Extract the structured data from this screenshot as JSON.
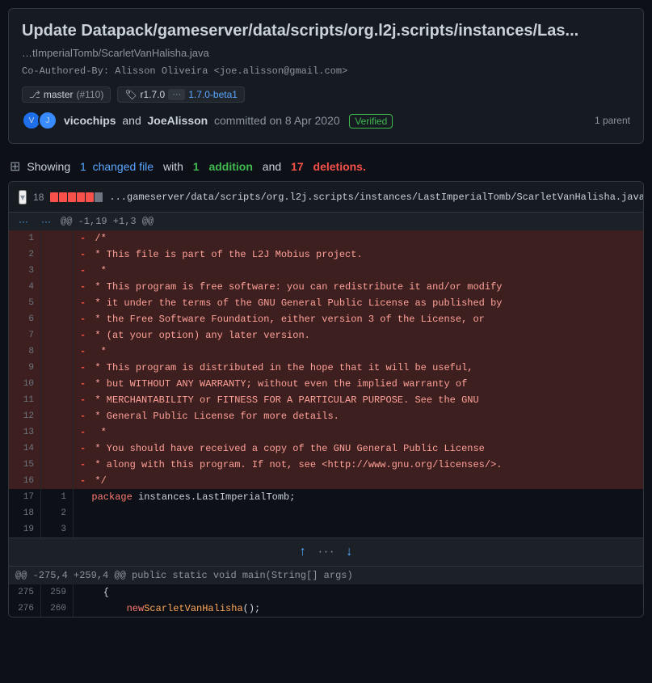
{
  "commit": {
    "title": "Update Datapack/gameserver/data/scripts/org.l2j.scripts/instances/Las...",
    "filepath": "…tImperialTomb/ScarletVanHalisha.java",
    "coauthored": "Co-Authored-By: Alisson Oliveira <joe.alisson@gmail.com>",
    "branch": "master",
    "pr_number": "(#110)",
    "tag": "r1.7.0",
    "tag_dots": "···",
    "tag_version": "1.7.0-beta1",
    "author1": "vicochips",
    "author2": "JoeAlisson",
    "committed_on": "committed on 8 Apr 2020",
    "verified_label": "Verified",
    "parent_label": "1 parent"
  },
  "diff_stats": {
    "showing_label": "Showing",
    "changed_count": "1",
    "changed_label": "changed file",
    "with_label": "with",
    "addition_count": "1",
    "addition_label": "addition",
    "and_label": "and",
    "deletion_count": "17",
    "deletion_label": "deletions."
  },
  "file_diff": {
    "changes_count": "18",
    "filename": "...gameserver/data/scripts/org.l2j.scripts/instances/LastImperialTomb/ScarletVanHalisha.java",
    "hunk_header": "@@ -1,19  +1,3 @@",
    "hunk_bottom": "@@ -275,4 +259,4 @@ public static void main(String[] args)",
    "lines": [
      {
        "old": "",
        "new": "",
        "type": "context",
        "content": "@@ -1,19  +1,3 @@"
      },
      {
        "old": "1",
        "new": "",
        "type": "del",
        "content": "- /*"
      },
      {
        "old": "2",
        "new": "",
        "type": "del",
        "content": "- * This file is part of the L2J Mobius project."
      },
      {
        "old": "3",
        "new": "",
        "type": "del",
        "content": "-  *"
      },
      {
        "old": "4",
        "new": "",
        "type": "del",
        "content": "- * This program is free software: you can redistribute it and/or modify"
      },
      {
        "old": "5",
        "new": "",
        "type": "del",
        "content": "- * it under the terms of the GNU General Public License as published by"
      },
      {
        "old": "6",
        "new": "",
        "type": "del",
        "content": "- * the Free Software Foundation, either version 3 of the License, or"
      },
      {
        "old": "7",
        "new": "",
        "type": "del",
        "content": "- * (at your option) any later version."
      },
      {
        "old": "8",
        "new": "",
        "type": "del",
        "content": "-  *"
      },
      {
        "old": "9",
        "new": "",
        "type": "del",
        "content": "- * This program is distributed in the hope that it will be useful,"
      },
      {
        "old": "10",
        "new": "",
        "type": "del",
        "content": "- * but WITHOUT ANY WARRANTY; without even the implied warranty of"
      },
      {
        "old": "11",
        "new": "",
        "type": "del",
        "content": "- * MERCHANTABILITY or FITNESS FOR A PARTICULAR PURPOSE. See the GNU"
      },
      {
        "old": "12",
        "new": "",
        "type": "del",
        "content": "- * General Public License for more details."
      },
      {
        "old": "13",
        "new": "",
        "type": "del",
        "content": "-  *"
      },
      {
        "old": "14",
        "new": "",
        "type": "del",
        "content": "- * You should have received a copy of the GNU General Public License"
      },
      {
        "old": "15",
        "new": "",
        "type": "del",
        "content": "- * along with this program. If not, see <http://www.gnu.org/licenses/>."
      },
      {
        "old": "16",
        "new": "",
        "type": "del",
        "content": "- */"
      },
      {
        "old": "17",
        "new": "1",
        "type": "normal",
        "content": "  package instances.LastImperialTomb;"
      },
      {
        "old": "18",
        "new": "2",
        "type": "normal",
        "content": ""
      },
      {
        "old": "19",
        "new": "3",
        "type": "normal",
        "content": ""
      }
    ],
    "bottom_lines": [
      {
        "old": "275",
        "new": "259",
        "type": "normal",
        "content": "    {"
      },
      {
        "old": "276",
        "new": "260",
        "type": "normal",
        "content": "        new ScarletVanHalisha();"
      }
    ]
  },
  "icons": {
    "branch": "⎇",
    "tag": "🏷",
    "toggle_down": "▾",
    "toggle_up": "▴",
    "diff_icon": "⊞",
    "expand_up": "↑",
    "expand_down": "↓",
    "file_icon": "📄",
    "copy_icon": "⧉"
  }
}
